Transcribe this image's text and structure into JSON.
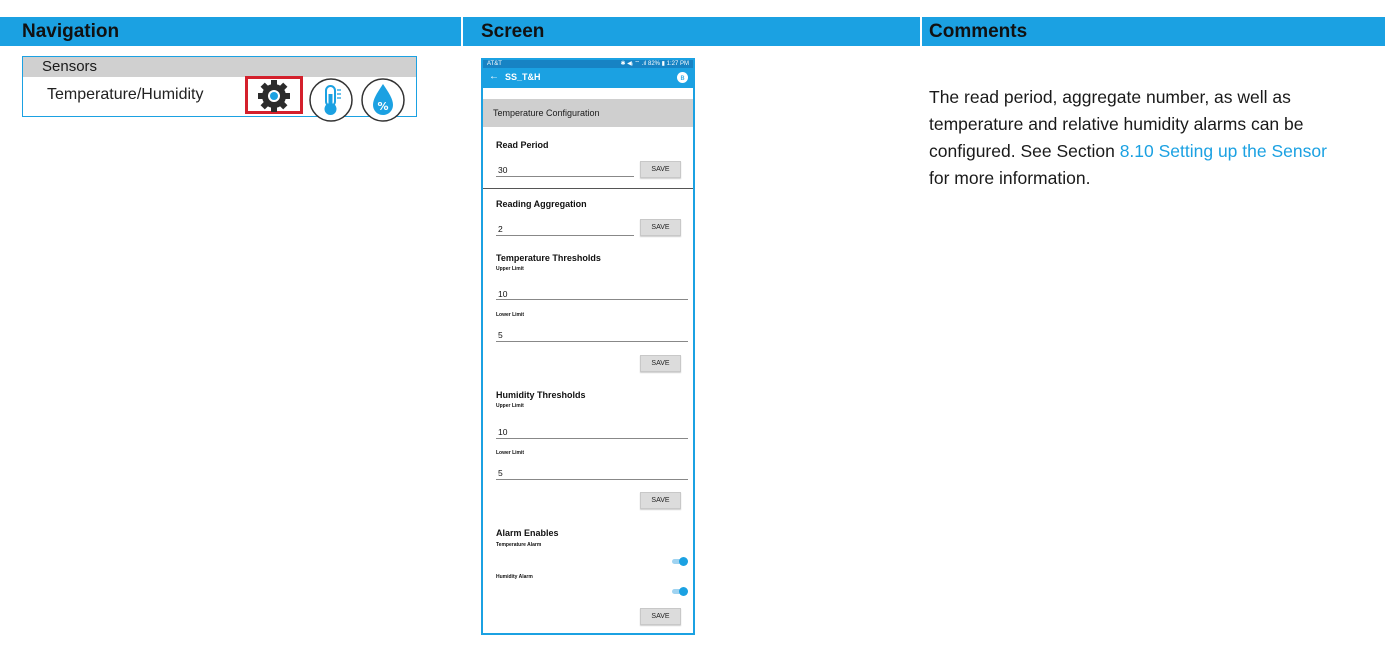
{
  "header": {
    "navigation": "Navigation",
    "screen": "Screen",
    "comments": "Comments",
    "bg_color": "#1ba1e2"
  },
  "nav": {
    "section": "Sensors",
    "item": "Temperature/Humidity",
    "icons": [
      "gear-icon",
      "thermometer-icon",
      "humidity-icon"
    ],
    "highlight_color": "#d4202c"
  },
  "phone": {
    "status": {
      "carrier": "AT&T",
      "right": "✱ ◀ᵢ ⌔ .ıl 82% ▮ 1:27 PM"
    },
    "appbar": {
      "back": "←",
      "title": "SS_T&H",
      "bt": "ʙ"
    },
    "section_title": "Temperature Configuration",
    "read_period": {
      "label": "Read Period",
      "value": "30",
      "save": "SAVE"
    },
    "aggregation": {
      "label": "Reading Aggregation",
      "value": "2",
      "save": "SAVE"
    },
    "temp_thresholds": {
      "label": "Temperature Thresholds",
      "upper_label": "Upper Limit",
      "upper_value": "10",
      "lower_label": "Lower Limit",
      "lower_value": "5",
      "save": "SAVE"
    },
    "hum_thresholds": {
      "label": "Humidity Thresholds",
      "upper_label": "Upper Limit",
      "upper_value": "10",
      "lower_label": "Lower Limit",
      "lower_value": "5",
      "save": "SAVE"
    },
    "alarms": {
      "label": "Alarm Enables",
      "temp_label": "Temperature Alarm",
      "temp_on": true,
      "hum_label": "Humidity Alarm",
      "hum_on": true,
      "save": "SAVE"
    }
  },
  "comments": {
    "text_before": "The read period, aggregate number, as well as temperature and relative humidity alarms can be configured. See Section ",
    "link": "8.10 Setting up the Sensor",
    "text_after": " for more information."
  }
}
